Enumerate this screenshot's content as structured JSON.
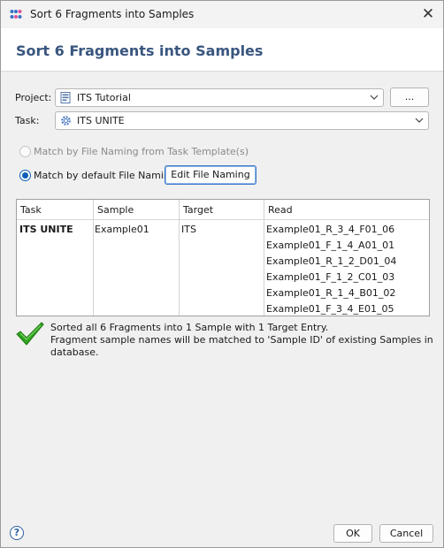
{
  "window": {
    "title": "Sort 6 Fragments into Samples",
    "header_title": "Sort 6 Fragments into Samples"
  },
  "form": {
    "project_label": "Project:",
    "project_value": "ITS Tutorial",
    "browse_label": "...",
    "task_label": "Task:",
    "task_value": "ITS UNITE"
  },
  "matching": {
    "option_template_label": "Match by File Naming from Task Template(s)",
    "option_template_enabled": false,
    "option_default_label": "Match by default File Naming",
    "option_default_selected": true,
    "edit_button_label": "Edit File Naming"
  },
  "table": {
    "headers": [
      "Task",
      "Sample",
      "Target",
      "Read"
    ],
    "task": "ITS UNITE",
    "sample": "Example01",
    "target": "ITS",
    "reads": [
      "Example01_R_3_4_F01_06",
      "Example01_F_1_4_A01_01",
      "Example01_R_1_2_D01_04",
      "Example01_F_1_2_C01_03",
      "Example01_R_1_4_B01_02",
      "Example01_F_3_4_E01_05"
    ]
  },
  "status": {
    "line1": "Sorted all 6 Fragments into 1 Sample with 1 Target Entry.",
    "line2": "Fragment sample names will be matched to 'Sample ID' of existing Samples in database.",
    "icon": "checkmark-icon",
    "color": "#2ea31d"
  },
  "footer": {
    "help_label": "?",
    "ok_label": "OK",
    "cancel_label": "Cancel"
  }
}
